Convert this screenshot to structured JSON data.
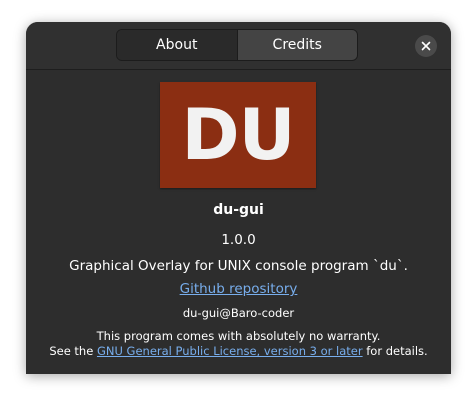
{
  "tabs": [
    {
      "label": "About",
      "active": true
    },
    {
      "label": "Credits",
      "active": false
    }
  ],
  "close_icon": "close-icon",
  "logo": {
    "text": "DU",
    "color": "#8b2e12"
  },
  "app": {
    "name": "du-gui",
    "version": "1.0.0",
    "comments": "Graphical Overlay for UNIX console program `du`.",
    "website_label": "Github repository",
    "copyright": "du-gui@Baro-coder"
  },
  "license": {
    "line1": "This program comes with absolutely no warranty.",
    "prefix": "See the ",
    "link": "GNU General Public License, version 3 or later",
    "suffix": " for details."
  },
  "colors": {
    "background": "#2d2d2d",
    "link": "#78aeed"
  }
}
